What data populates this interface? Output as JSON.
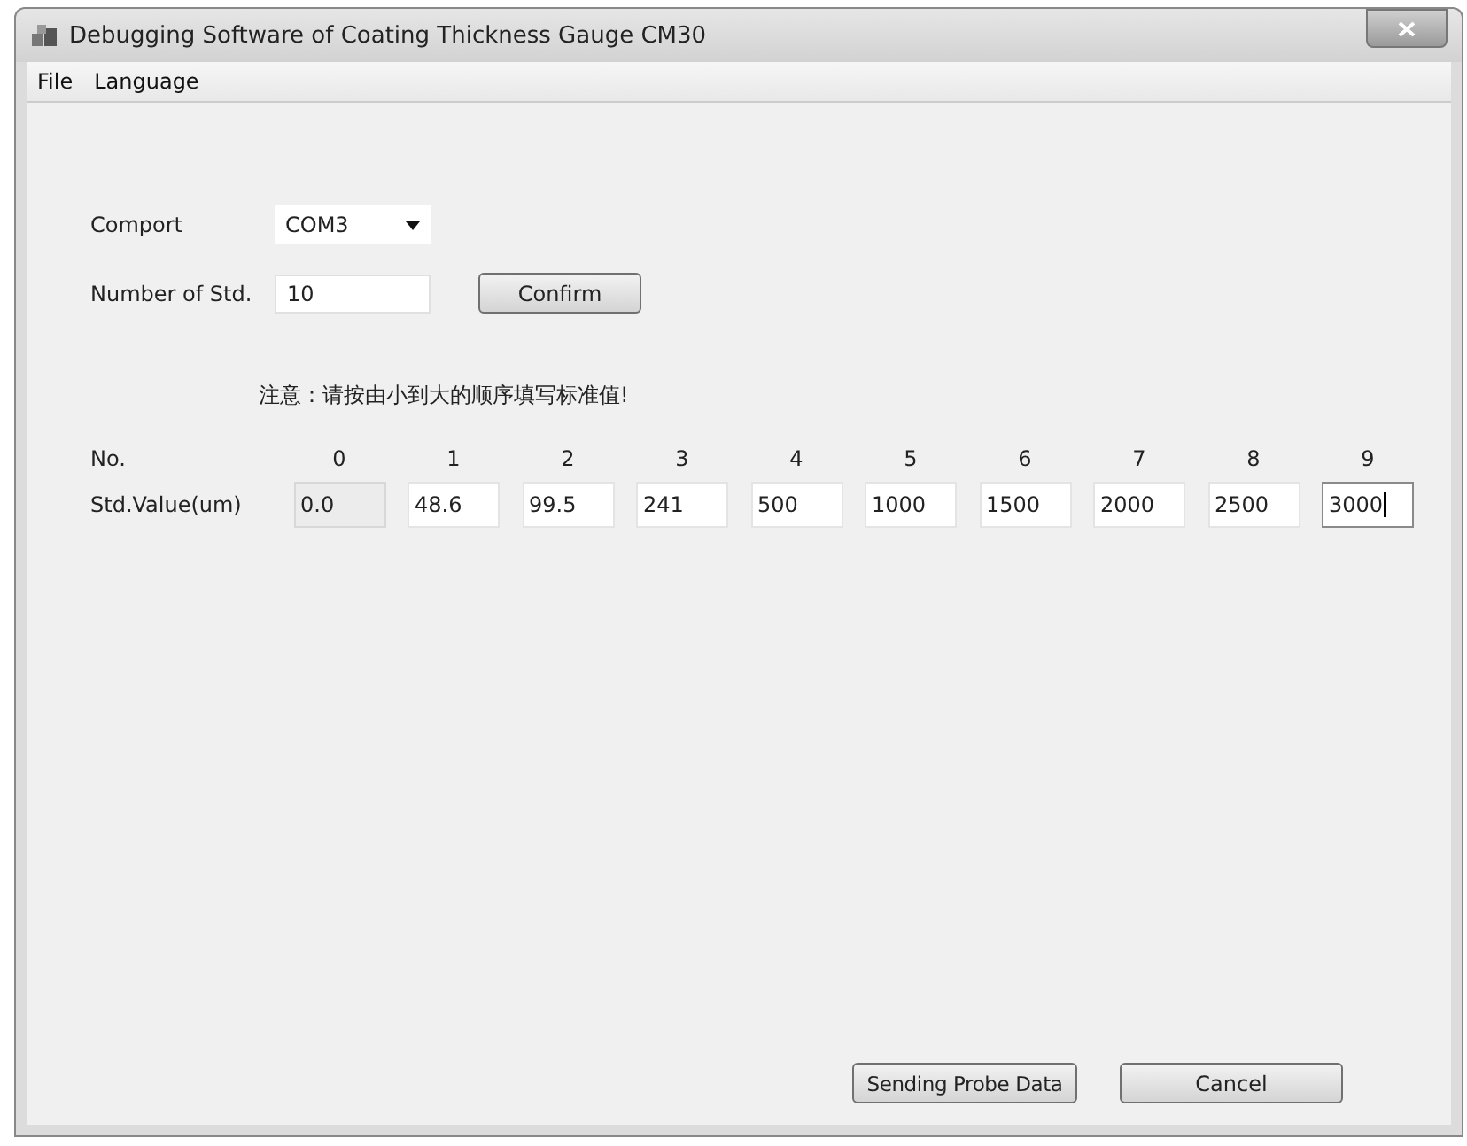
{
  "window": {
    "title": "Debugging Software of Coating Thickness Gauge CM30"
  },
  "menu": [
    "File",
    "Language"
  ],
  "comport": {
    "label": "Comport",
    "value": "COM3"
  },
  "number_of_std": {
    "label": "Number of Std.",
    "value": "10"
  },
  "confirm_button": "Confirm",
  "note": "注意：请按由小到大的顺序填写标准值!",
  "table": {
    "header_label": "No.",
    "value_label": "Std.Value(um)",
    "columns": [
      {
        "no": "0",
        "value": "0.0",
        "disabled": true,
        "focused": false
      },
      {
        "no": "1",
        "value": "48.6",
        "disabled": false,
        "focused": false
      },
      {
        "no": "2",
        "value": "99.5",
        "disabled": false,
        "focused": false
      },
      {
        "no": "3",
        "value": "241",
        "disabled": false,
        "focused": false
      },
      {
        "no": "4",
        "value": "500",
        "disabled": false,
        "focused": false
      },
      {
        "no": "5",
        "value": "1000",
        "disabled": false,
        "focused": false
      },
      {
        "no": "6",
        "value": "1500",
        "disabled": false,
        "focused": false
      },
      {
        "no": "7",
        "value": "2000",
        "disabled": false,
        "focused": false
      },
      {
        "no": "8",
        "value": "2500",
        "disabled": false,
        "focused": false
      },
      {
        "no": "9",
        "value": "3000",
        "disabled": false,
        "focused": true
      }
    ]
  },
  "buttons": [
    "Sending Probe Data",
    "Cancel"
  ]
}
